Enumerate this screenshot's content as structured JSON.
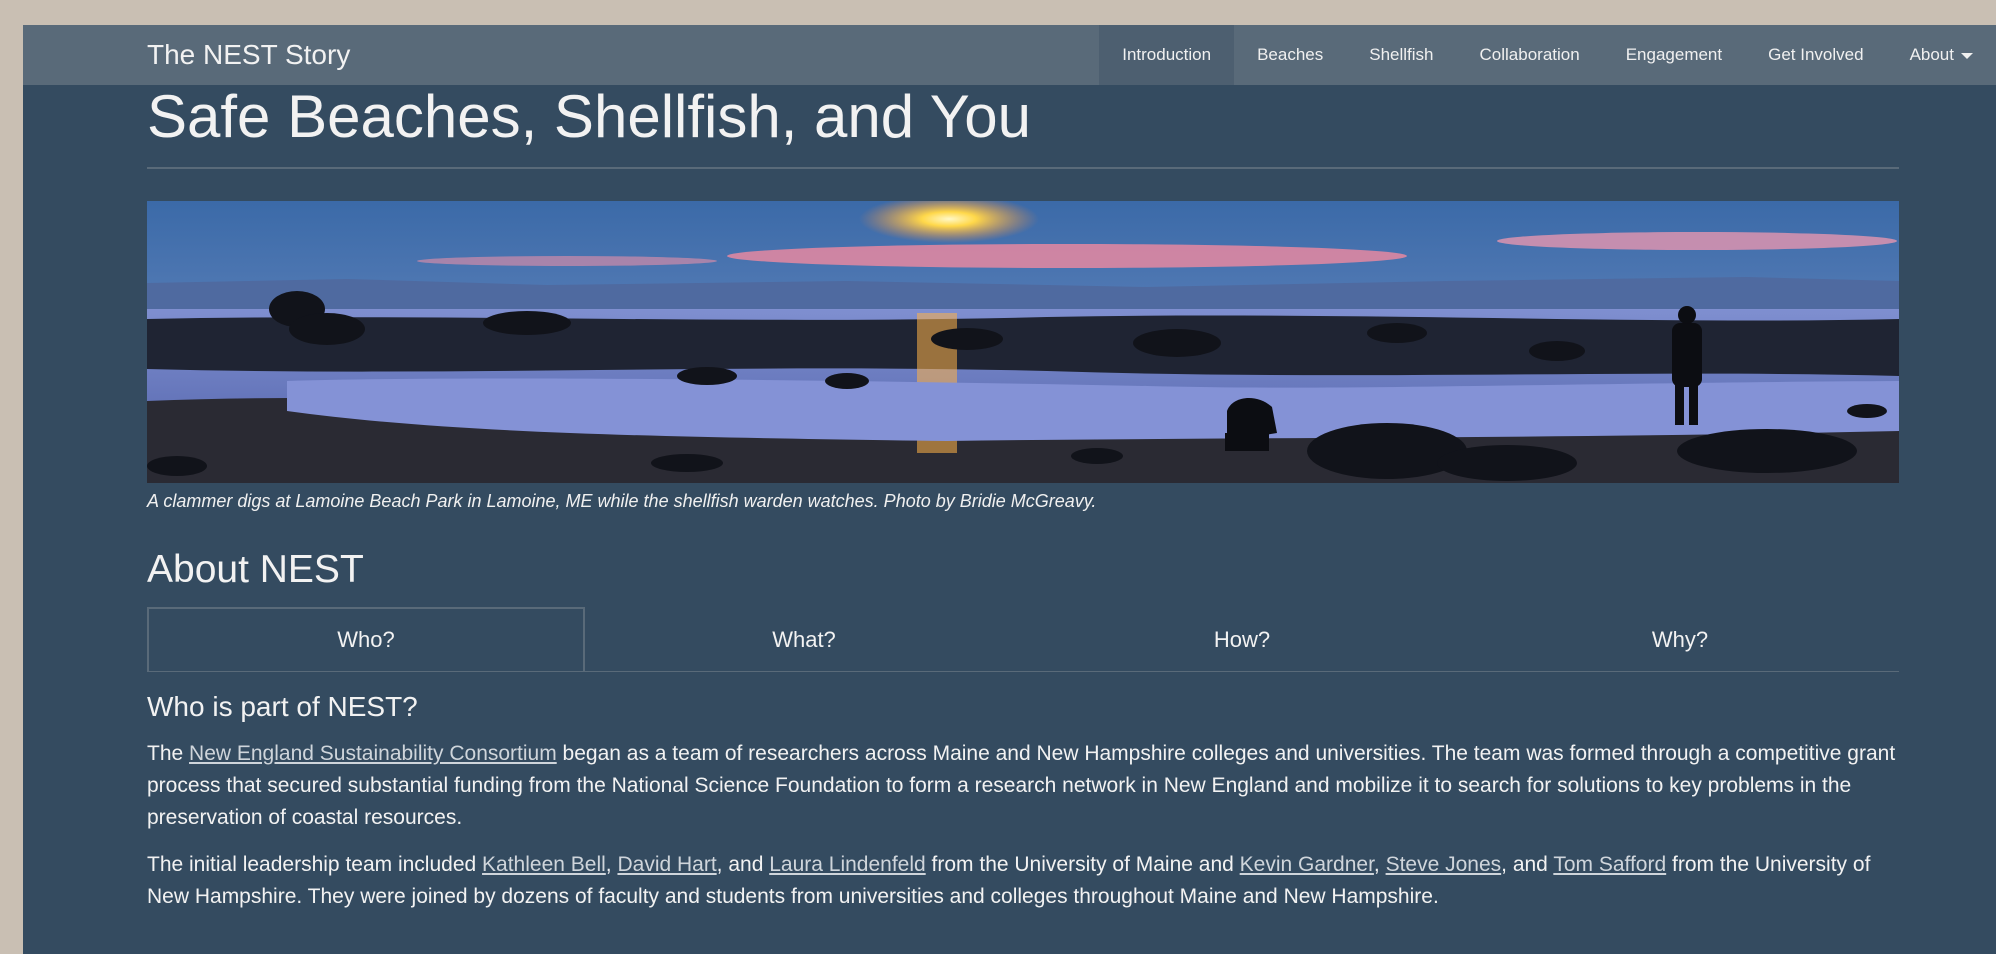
{
  "navbar": {
    "brand": "The NEST Story",
    "items": [
      {
        "label": "Introduction",
        "active": true
      },
      {
        "label": "Beaches"
      },
      {
        "label": "Shellfish"
      },
      {
        "label": "Collaboration"
      },
      {
        "label": "Engagement"
      },
      {
        "label": "Get Involved"
      },
      {
        "label": "About",
        "dropdown": true
      }
    ]
  },
  "page": {
    "title": "Safe Beaches, Shellfish, and You",
    "hero_caption": "A clammer digs at Lamoine Beach Park in Lamoine, ME while the shellfish warden watches. Photo by Bridie McGreavy."
  },
  "about": {
    "title": "About NEST",
    "tabs": [
      {
        "label": "Who?",
        "active": true
      },
      {
        "label": "What?"
      },
      {
        "label": "How?"
      },
      {
        "label": "Why?"
      }
    ],
    "active_tab": {
      "heading": "Who is part of NEST?",
      "p1": {
        "before": "The ",
        "link": "New England Sustainability Consortium",
        "after": " began as a team of researchers across Maine and New Hampshire colleges and universities. The team was formed through a competitive grant process that secured substantial funding from the National Science Foundation to form a research network in New England and mobilize it to search for solutions to key problems in the preservation of coastal resources."
      },
      "p2": {
        "t1": "The initial leadership team included ",
        "l1": "Kathleen Bell",
        "t2": ", ",
        "l2": "David Hart",
        "t3": ", and ",
        "l3": "Laura Lindenfeld",
        "t4": " from the University of Maine and ",
        "l4": "Kevin Gardner",
        "t5": ", ",
        "l5": "Steve Jones",
        "t6": ", and ",
        "l6": "Tom Safford",
        "t7": " from the University of New Hampshire. They were joined by dozens of faculty and students from universities and colleges throughout Maine and New Hampshire."
      }
    }
  },
  "colors": {
    "page_bg": "#344b60",
    "navbar_bg": "#596a79",
    "text": "#f2f2f2",
    "link": "#cfd5db"
  }
}
